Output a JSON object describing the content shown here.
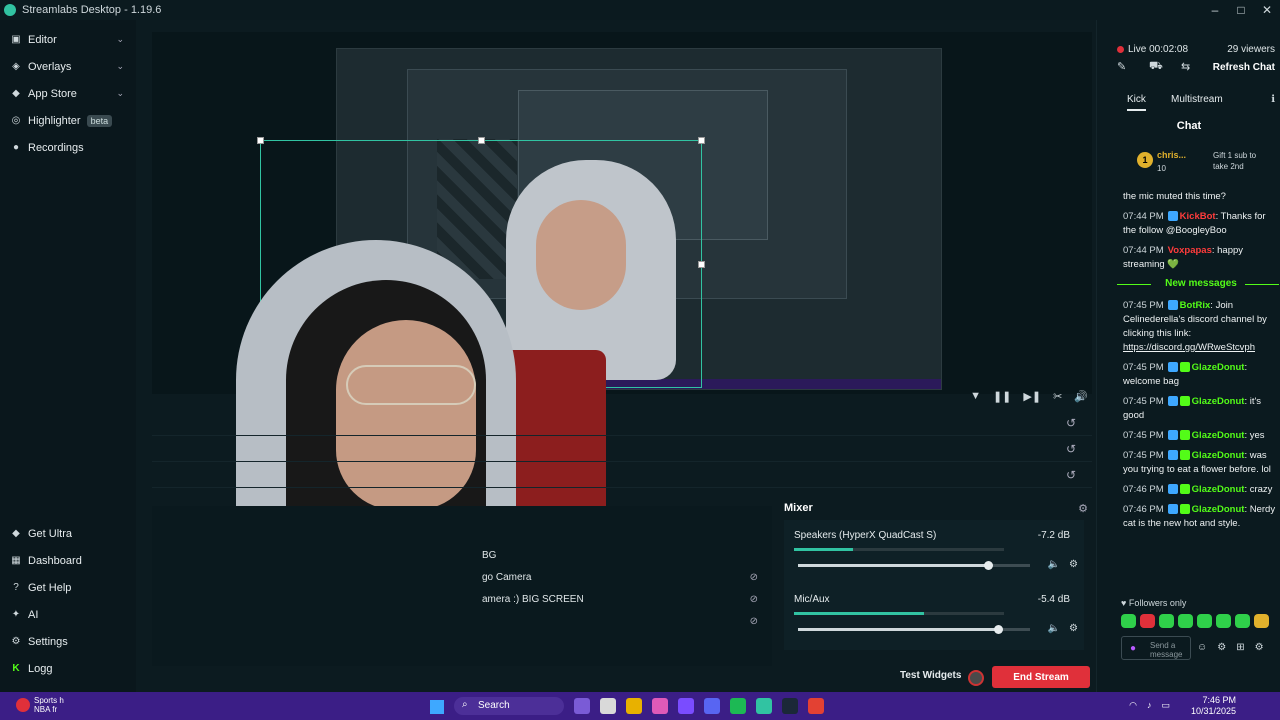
{
  "window": {
    "title": "Streamlabs Desktop - 1.19.6",
    "min": "–",
    "max": "□",
    "close": "✕"
  },
  "sidebar": {
    "items": [
      {
        "label": "Editor",
        "icon": "editor-icon",
        "glyph": "▣",
        "chevron": "⌄"
      },
      {
        "label": "Overlays",
        "icon": "overlays-icon",
        "glyph": "◈",
        "chevron": "⌄"
      },
      {
        "label": "App Store",
        "icon": "app-store-icon",
        "glyph": "◆",
        "chevron": "⌄"
      },
      {
        "label": "Highlighter",
        "icon": "highlighter-icon",
        "glyph": "◎",
        "badge": "beta"
      },
      {
        "label": "Recordings",
        "icon": "recordings-icon",
        "glyph": "●"
      }
    ],
    "bottom": [
      {
        "label": "Get Ultra",
        "icon": "ultra-icon",
        "glyph": "◆"
      },
      {
        "label": "Dashboard",
        "icon": "dashboard-icon",
        "glyph": "▦"
      },
      {
        "label": "Get Help",
        "icon": "help-icon",
        "glyph": "?"
      },
      {
        "label": "AI",
        "icon": "ai-icon",
        "glyph": "✦"
      },
      {
        "label": "Settings",
        "icon": "settings-icon",
        "glyph": "⚙"
      },
      {
        "label": "Logg",
        "icon": "kick-icon",
        "glyph": "K"
      }
    ]
  },
  "preview": {
    "toolbar_icons": [
      "▼",
      "❚❚",
      "▶❚",
      "✂",
      "🔊"
    ],
    "reload": "↺"
  },
  "sources": {
    "items": [
      "BG",
      "go Camera",
      "amera :) BIG SCREEN"
    ],
    "visible_icon": "⊘"
  },
  "mixer": {
    "title": "Mixer",
    "gear": "⚙",
    "tracks": [
      {
        "name": "Speakers (HyperX QuadCast S)",
        "db": "-7.2 dB",
        "level": 0.28,
        "volume": 0.82
      },
      {
        "name": "Mic/Aux",
        "db": "-5.4 dB",
        "level": 0.62,
        "volume": 0.86
      }
    ],
    "mute_icon": "🔈",
    "track_gear": "⚙"
  },
  "footer": {
    "test_widgets": "Test Widgets",
    "end_stream": "End Stream"
  },
  "chat_panel": {
    "live_label": "Live 00:02:08",
    "viewers": "29 viewers",
    "refresh": "Refresh Chat",
    "tool_icons": [
      "✎",
      "⛟",
      "⇆"
    ],
    "tabs": [
      "Kick",
      "Multistream"
    ],
    "info_icon": "ℹ",
    "title": "Chat",
    "pinned": {
      "badge": "1",
      "name": "chris...",
      "count": "10",
      "text": "Gift 1 sub to take 2nd"
    },
    "messages_before": [
      {
        "time": "",
        "user": "",
        "text": "the mic muted this time?"
      },
      {
        "time": "07:44 PM",
        "user": "KickBot",
        "user_color": "red",
        "text": ": Thanks for the follow @BoogleyBoo"
      },
      {
        "time": "07:44 PM",
        "user": "Voxpapas",
        "user_color": "red",
        "text": ": happy streaming 💚"
      }
    ],
    "new_messages": "New messages",
    "messages_after": [
      {
        "time": "07:45 PM",
        "user": "BotRix",
        "text": ": Join Celinederella's discord channel by clicking this link: ",
        "link": "https://discord.gg/WRweStcvph"
      },
      {
        "time": "07:45 PM",
        "user": "GlazeDonut",
        "text": ": welcome bag"
      },
      {
        "time": "07:45 PM",
        "user": "GlazeDonut",
        "text": ": it's good"
      },
      {
        "time": "07:45 PM",
        "user": "GlazeDonut",
        "text": ": yes"
      },
      {
        "time": "07:45 PM",
        "user": "GlazeDonut",
        "text": ": was you trying to eat a flower before. lol"
      },
      {
        "time": "07:46 PM",
        "user": "GlazeDonut",
        "text": ": crazy"
      },
      {
        "time": "07:46 PM",
        "user": "GlazeDonut",
        "text": ": Nerdy cat is the new hot and style."
      }
    ],
    "followers_only": "♥ Followers only",
    "send_placeholder": "Send a message",
    "input_icons": [
      "☺",
      "⚙",
      "⊞",
      "⚙"
    ]
  },
  "taskbar": {
    "sports_title": "Sports h",
    "sports_sub": "NBA fr",
    "search": "Search",
    "time": "7:46 PM",
    "date": "10/31/2025",
    "app_colors": [
      "#7a5bd6",
      "#d9d9d9",
      "#e8b100",
      "#e05ab8",
      "#7a4cff",
      "#5865f2",
      "#1db954",
      "#31c3a2",
      "#1b2838",
      "#e34133"
    ]
  }
}
